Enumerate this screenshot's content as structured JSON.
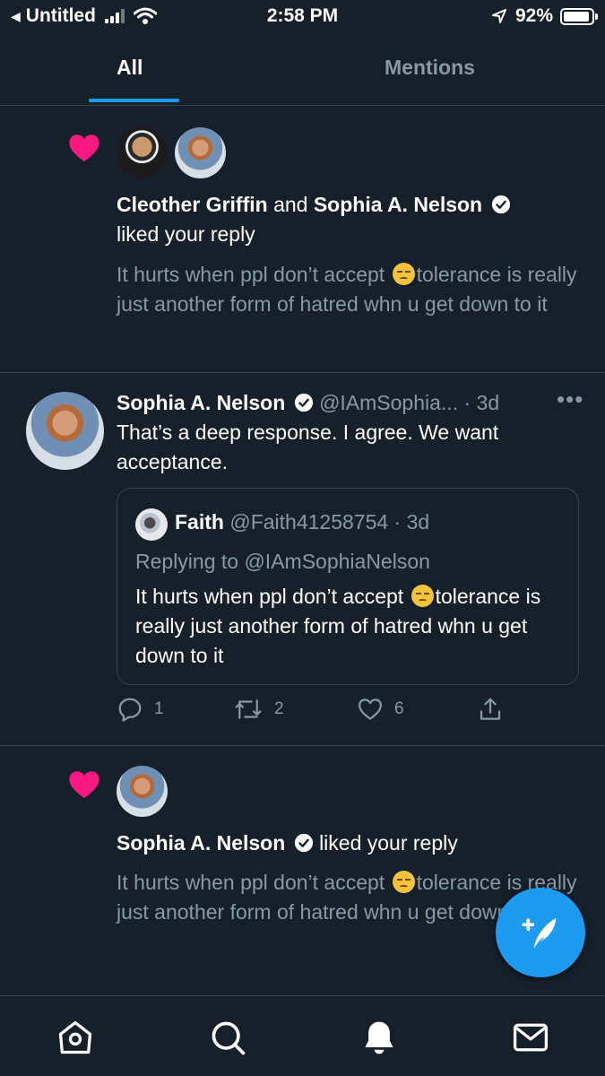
{
  "status_bar": {
    "back_app": "Untitled",
    "time": "2:58 PM",
    "battery": "92%",
    "battery_level": 0.92
  },
  "tabs": [
    {
      "label": "All",
      "selected": true
    },
    {
      "label": "Mentions",
      "selected": false
    }
  ],
  "notifications": [
    {
      "type": "like",
      "liker_1": "Cleother Griffin",
      "conjunction": "and",
      "liker_2": "Sophia A. Nelson",
      "action_text": "liked your reply",
      "preview_before_emoji": "It hurts when ppl don’t accept ",
      "preview_after_emoji": "tolerance is really just another form of hatred whn u get down to it"
    },
    {
      "type": "reply",
      "author_name": "Sophia A. Nelson",
      "author_handle": "@IAmSophia...",
      "time": "3d",
      "text": "That’s a deep response. I agree. We want acceptance.",
      "quoted": {
        "author_name": "Faith",
        "author_handle": "@Faith41258754",
        "time": "3d",
        "replying_to": "Replying to @IAmSophiaNelson",
        "text_before_emoji": "It hurts when ppl don’t accept ",
        "text_after_emoji": "tolerance is really just another form of hatred whn u get down to it"
      },
      "stats": {
        "replies": "1",
        "retweets": "2",
        "likes": "6"
      }
    },
    {
      "type": "like",
      "liker_1": "Sophia A. Nelson",
      "action_text": "liked your reply",
      "preview_before_emoji": "It hurts when ppl don’t accept ",
      "preview_after_emoji": "tolerance is really just another form of hatred whn u get down to it"
    }
  ],
  "bottom_nav": [
    "home-icon",
    "search-icon",
    "notifications-icon",
    "messages-icon"
  ],
  "colors": {
    "background": "#15202b",
    "accent": "#1d9bf0",
    "like": "#f91880",
    "muted": "#8899a6",
    "divider": "#38444d"
  }
}
